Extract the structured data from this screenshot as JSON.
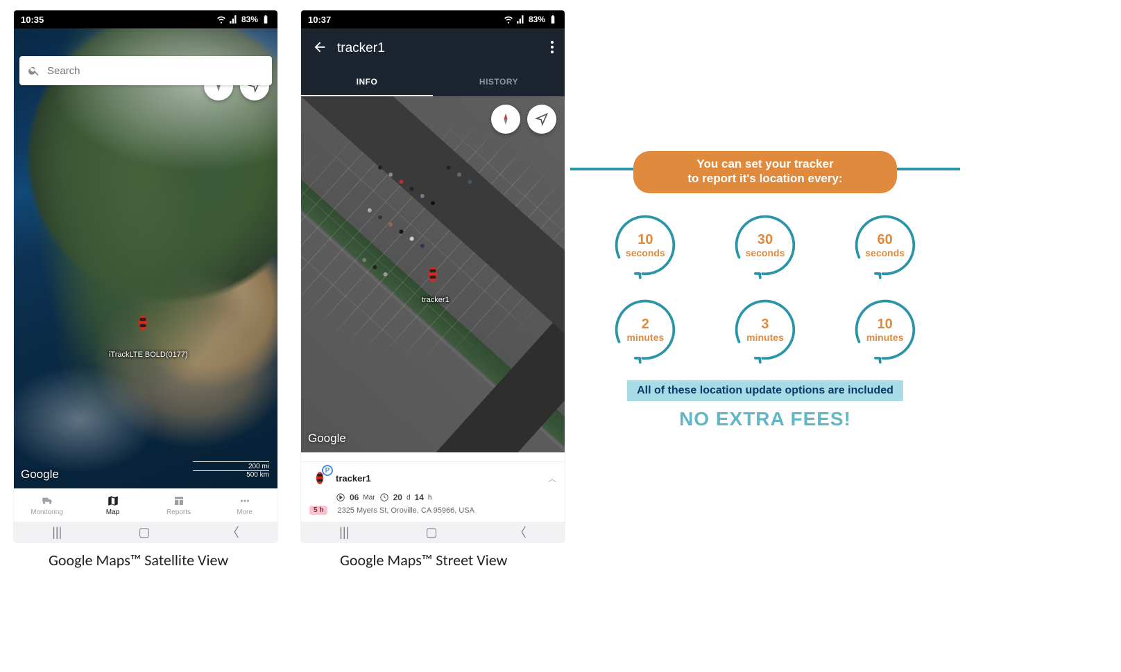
{
  "phone1": {
    "status": {
      "time": "10:35",
      "battery": "83%"
    },
    "search": {
      "placeholder": "Search"
    },
    "marker_label": "iTrackLTE BOLD(0177)",
    "google": "Google",
    "scale": {
      "mi": "200 mi",
      "km": "500 km"
    },
    "nav": {
      "monitoring": "Monitoring",
      "map": "Map",
      "reports": "Reports",
      "more": "More"
    },
    "caption": "Google Maps™ Satellite View"
  },
  "phone2": {
    "status": {
      "time": "10:37",
      "battery": "83%"
    },
    "title": "tracker1",
    "tabs": {
      "info": "INFO",
      "history": "HISTORY"
    },
    "marker_label": "tracker1",
    "google": "Google",
    "info": {
      "p_badge": "P",
      "name": "tracker1",
      "date_num": "06",
      "date_mon": "Mar",
      "dur_d": "20",
      "dur_d_u": "d",
      "dur_h": "14",
      "dur_h_u": "h",
      "age": "5 h",
      "address": "2325 Myers St, Oroville, CA 95966, USA"
    },
    "caption": "Google Maps™ Street View"
  },
  "promo": {
    "headline_l1": "You can set your tracker",
    "headline_l2": "to report it's location every:",
    "options": [
      {
        "num": "10",
        "unit": "seconds"
      },
      {
        "num": "30",
        "unit": "seconds"
      },
      {
        "num": "60",
        "unit": "seconds"
      },
      {
        "num": "2",
        "unit": "minutes"
      },
      {
        "num": "3",
        "unit": "minutes"
      },
      {
        "num": "10",
        "unit": "minutes"
      }
    ],
    "sub": "All of these location update options are included",
    "nofees": "NO EXTRA FEES!"
  }
}
